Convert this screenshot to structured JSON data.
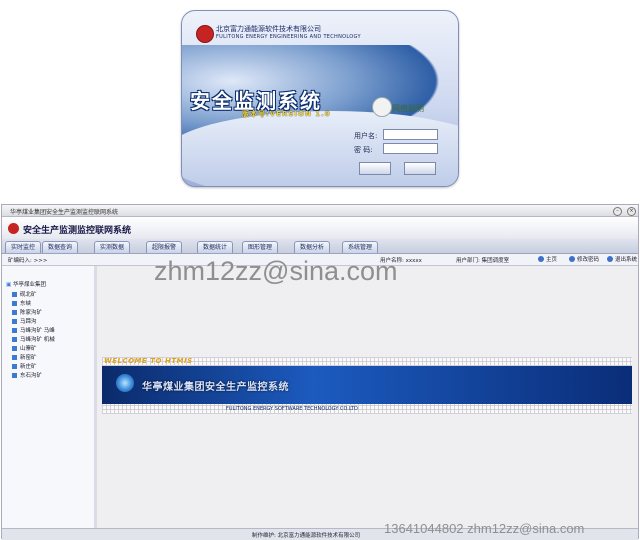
{
  "login": {
    "company_cn": "北京富力通能源软件技术有限公司",
    "company_en": "FULITONG ENERGY ENGINEERING AND TECHNOLOGY",
    "title": "安全监测系统",
    "version": "版本号:VERSION 1.0",
    "badge_text": "网络监测",
    "username_label": "用户名:",
    "password_label": "密  码:"
  },
  "app": {
    "window_title": "华亭煤业集团安全生产监测监控联网系统",
    "header_title": "安全生产监测监控联网系统",
    "tabs": [
      "实时监控",
      "数据查询",
      "实测数据",
      "超限报警",
      "数据统计",
      "图形管理",
      "数据分析",
      "系统管理"
    ],
    "info": {
      "location": "矿编码入: >>>",
      "user": "用户名称: xxxxx",
      "dept": "用户部门: 集团调度室",
      "btn_home": "主页",
      "btn_password": "修改密码",
      "btn_exit": "退出系统"
    },
    "tree": {
      "root": "华亭煤业集团",
      "items": [
        "砚北矿",
        "东峡",
        "陈家沟矿",
        "马蹄沟",
        "马峰沟矿 马峰",
        "马峰沟矿 机械",
        "山寨矿",
        "新窑矿",
        "新庄矿",
        "东石沟矿"
      ]
    },
    "welcome": "WELCOME TO HTMIS",
    "banner_title": "华亭煤业集团安全生产监控系统",
    "banner_sub": "FULITONG ENERGY SOFTWARE TECHNOLOGY CO.LTD",
    "footer": "制作维护: 北京富力通能源软件技术有限公司"
  },
  "watermark": {
    "email": "zhm12zz@sina.com",
    "contact": "13641044802  zhm12zz@sina.com"
  }
}
